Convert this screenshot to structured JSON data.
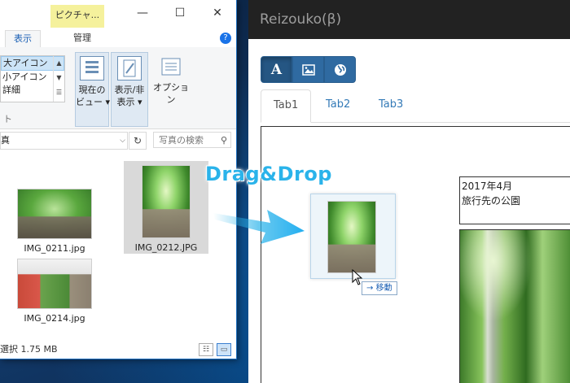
{
  "explorer": {
    "context_tab": "ピクチャ...",
    "window_controls": [
      "—",
      "☐",
      "✕"
    ],
    "ribbon_tabs": [
      {
        "label": "表示",
        "active": true
      },
      {
        "label": "管理",
        "active": false
      }
    ],
    "help": "?",
    "layout_options": [
      {
        "label": "大アイコン",
        "selected": true
      },
      {
        "label": "小アイコン",
        "selected": false
      },
      {
        "label": "詳細",
        "selected": false
      }
    ],
    "ribbon_buttons": {
      "current_view": "現在の\nビュー ▾",
      "show_hide": "表示/非\n表示 ▾",
      "options": "オプション"
    },
    "group_label": "ト",
    "address": "真",
    "search_placeholder": "写真の検索",
    "files": [
      {
        "name": "IMG_0211.jpg",
        "thumb": "forest"
      },
      {
        "name": "IMG_0212.JPG",
        "thumb": "tunnel",
        "selected": true
      },
      {
        "name": "IMG_0214.jpg",
        "thumb": "park"
      }
    ],
    "status": "選択  1.75 MB"
  },
  "drag": {
    "label": "Drag&Drop",
    "tooltip_arrow": "→",
    "tooltip_text": "移動"
  },
  "app": {
    "title": "Reizouko(β)",
    "tools": [
      {
        "name": "text",
        "glyph": "A",
        "active": true
      },
      {
        "name": "image",
        "glyph": "🖼",
        "active": false
      },
      {
        "name": "web",
        "glyph": "🌐",
        "active": false
      }
    ],
    "tabs": [
      {
        "label": "Tab1",
        "active": true
      },
      {
        "label": "Tab2",
        "active": false
      },
      {
        "label": "Tab3",
        "active": false
      }
    ],
    "note": {
      "line1": "2017年4月",
      "line2": "旅行先の公園"
    }
  },
  "colors": {
    "accent": "#337ab7",
    "toolbar": "#2f6aa1",
    "navbar": "#222222",
    "drag_label": "#2ab3ea"
  }
}
